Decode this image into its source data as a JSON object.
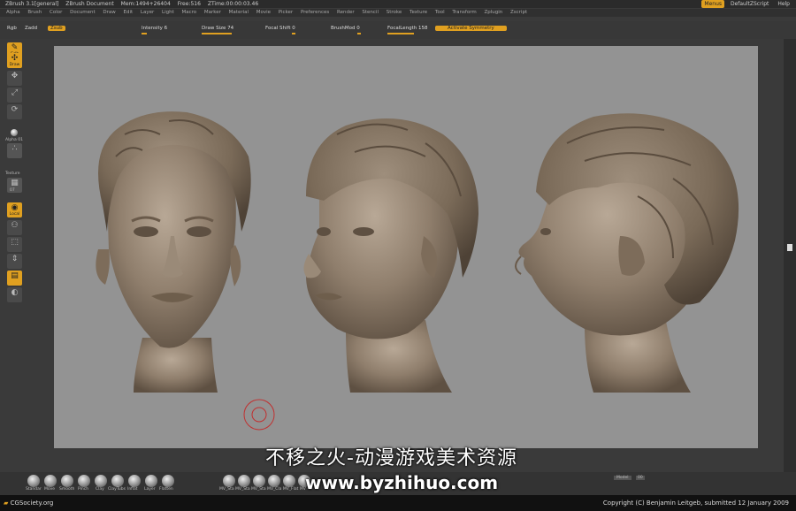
{
  "titlebar": {
    "app": "ZBrush 3.1[general]",
    "document": "ZBrush Document",
    "mem": "Mem:1494+26404",
    "free": "Free:516",
    "ztime": "ZTime:00:00:03.46",
    "menus_label": "Menus",
    "script_label": "DefaultZScript",
    "help_label": "Help"
  },
  "menubar": [
    "Alpha",
    "Brush",
    "Color",
    "Document",
    "Draw",
    "Edit",
    "Layer",
    "Light",
    "Macro",
    "Marker",
    "Material",
    "Movie",
    "Picker",
    "Preferences",
    "Render",
    "Stencil",
    "Stroke",
    "Texture",
    "Tool",
    "Transform",
    "Zplugin",
    "Zscript"
  ],
  "toolbar": {
    "rgb": "Rgb",
    "zadd": "Zadd",
    "zsub": "Zsub",
    "z_intensity": "Intensity 6",
    "draw_size": "Draw Size 74",
    "focal_shift": "Focal Shift 0",
    "brush_mod": "BrushMod 0",
    "focal_length": "FocalLength 158",
    "symmetry": "Activate Symmetry"
  },
  "leftshelf": {
    "edit": "Edit",
    "draw": "Draw",
    "alpha": "Alpha 01",
    "texture": "Texture",
    "texture_num": "07",
    "local": "Local"
  },
  "bottomshelf": {
    "brushes": [
      "Standar",
      "Move",
      "Smooth",
      "Pinch",
      "Clay",
      "ClayTubs",
      "Inflat",
      "Layer",
      "Flatten"
    ],
    "mv": "MV_Sta MV_Sta MV_Sta MV_Cla MV_Flat MV",
    "model": "Model",
    "model_num": "00"
  },
  "footer": {
    "left": "CGSociety.org",
    "right": "Copyright (C) Benjamin Leitgeb, submitted 12 January 2009"
  },
  "watermark": {
    "line1": "不移之火-动漫游戏美术资源",
    "line2": "www.byzhihuo.com"
  },
  "colors": {
    "accent": "#e0a020",
    "canvas": "#939393",
    "clay": "#8a7a68"
  }
}
